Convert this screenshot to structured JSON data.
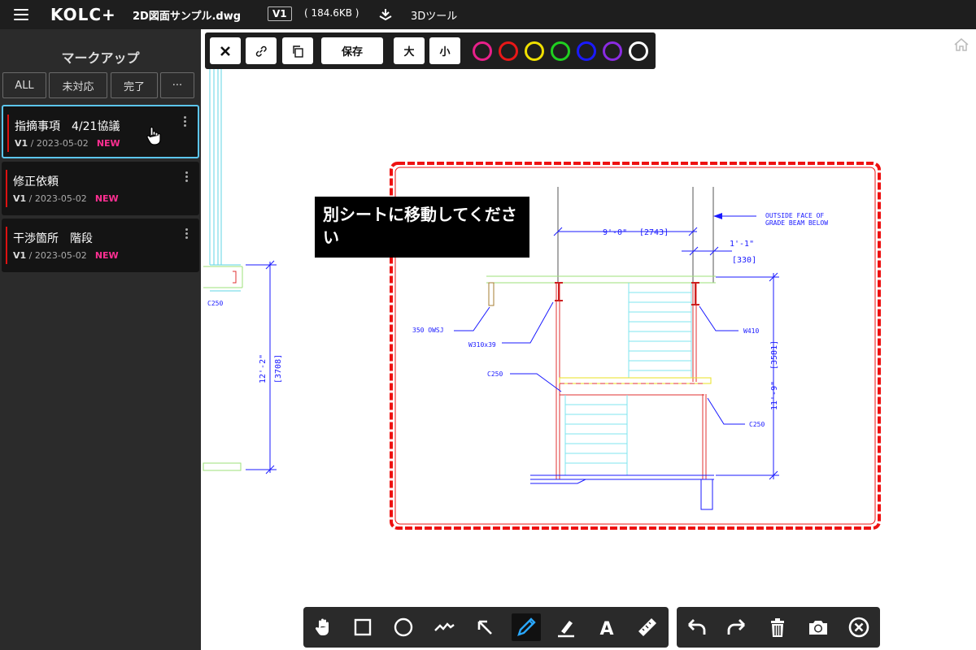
{
  "app": {
    "logo": "KOLC+",
    "file_name": "2D図面サンプル.dwg",
    "version_badge": "V1",
    "file_size": "( 184.6KB )",
    "tool_3d_label": "3Dツール"
  },
  "sidebar": {
    "title": "マークアップ",
    "filters": [
      "ALL",
      "未対応",
      "完了",
      "···"
    ],
    "cards": [
      {
        "title": "指摘事項　4/21協議",
        "version": "V1",
        "date": " / 2023-05-02",
        "badge": "NEW"
      },
      {
        "title": "修正依頼",
        "version": "V1",
        "date": " / 2023-05-02",
        "badge": "NEW"
      },
      {
        "title": "干渉箇所　階段",
        "version": "V1",
        "date": " / 2023-05-02",
        "badge": "NEW"
      }
    ]
  },
  "toolbar": {
    "save_label": "保存",
    "large_label": "大",
    "small_label": "小",
    "colors": [
      "#e8208a",
      "#e81818",
      "#f0e000",
      "#20d020",
      "#1a1aff",
      "#8a2be2",
      "#ffffff"
    ]
  },
  "annotation": {
    "text": "別シートに移動してください"
  },
  "drawing": {
    "dim_9_0": "9'-0\"",
    "dim_2743": "[2743]",
    "dim_1_1": "1'-1\"",
    "dim_330": "[330]",
    "outside_face_1": "OUTSIDE FACE OF",
    "outside_face_2": "GRADE BEAM BELOW",
    "label_owsj": "350 OWSJ",
    "label_w310": "W310x39",
    "label_w410": "W410",
    "label_c250_a": "C250",
    "label_c250_b": "C250",
    "label_c250_left": "C250",
    "dim_11_9": "11'-9\"",
    "dim_3581": "[3581]",
    "dim_12_2": "12'-2\"",
    "dim_3708": "[3708]"
  },
  "bottom_tools": [
    "hand-icon",
    "rectangle-icon",
    "circle-icon",
    "freehand-line-icon",
    "arrow-icon",
    "pen-icon",
    "highlighter-icon",
    "text-icon",
    "ruler-icon"
  ],
  "bottom_actions": [
    "undo-icon",
    "redo-icon",
    "trash-icon",
    "camera-icon",
    "close-circle-icon"
  ]
}
